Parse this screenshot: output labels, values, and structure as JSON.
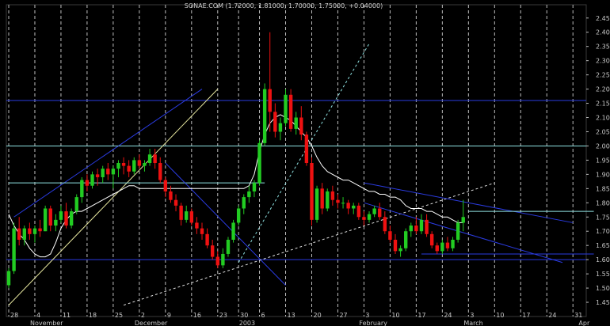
{
  "chart_data": {
    "type": "candlestick",
    "title": "SONAE.COM (1.72000, 1.81000, 1.70000, 1.75000, +0.04000)",
    "xlabel": "",
    "ylabel": "",
    "ylim": [
      1.4,
      2.48
    ],
    "y_ticks": [
      "2.45",
      "2.40",
      "2.35",
      "2.30",
      "2.25",
      "2.20",
      "2.15",
      "2.10",
      "2.05",
      "2.00",
      "1.95",
      "1.90",
      "1.85",
      "1.80",
      "1.75",
      "1.70",
      "1.65",
      "1.60",
      "1.55",
      "1.50",
      "1.45"
    ],
    "x_day_ticks": [
      {
        "label": "28",
        "i": 0
      },
      {
        "label": "4",
        "i": 5
      },
      {
        "label": "11",
        "i": 10
      },
      {
        "label": "18",
        "i": 15
      },
      {
        "label": "25",
        "i": 20
      },
      {
        "label": "2",
        "i": 25
      },
      {
        "label": "9",
        "i": 30
      },
      {
        "label": "16",
        "i": 35
      },
      {
        "label": "23",
        "i": 40
      },
      {
        "label": "30",
        "i": 44
      },
      {
        "label": "6",
        "i": 48
      },
      {
        "label": "13",
        "i": 53
      },
      {
        "label": "20",
        "i": 58
      },
      {
        "label": "27",
        "i": 63
      },
      {
        "label": "3",
        "i": 68
      },
      {
        "label": "10",
        "i": 73
      },
      {
        "label": "17",
        "i": 78
      },
      {
        "label": "24",
        "i": 83
      },
      {
        "label": "3",
        "i": 88
      },
      {
        "label": "10",
        "i": 93
      },
      {
        "label": "17",
        "i": 98
      },
      {
        "label": "24",
        "i": 103
      },
      {
        "label": "31",
        "i": 108
      }
    ],
    "x_month_ticks": [
      {
        "label": "November",
        "i": 5
      },
      {
        "label": "December",
        "i": 25
      },
      {
        "label": "2003",
        "i": 45
      },
      {
        "label": "February",
        "i": 68
      },
      {
        "label": "March",
        "i": 88
      },
      {
        "label": "Apr",
        "i": 110
      }
    ],
    "horizontal_levels": [
      2.16,
      2.0,
      1.6
    ],
    "series": [
      {
        "name": "",
        "ohlc": [
          [
            1.51,
            1.57,
            1.5,
            1.56
          ],
          [
            1.56,
            1.73,
            1.55,
            1.71
          ],
          [
            1.71,
            1.75,
            1.65,
            1.67
          ],
          [
            1.67,
            1.72,
            1.65,
            1.71
          ],
          [
            1.71,
            1.73,
            1.67,
            1.69
          ],
          [
            1.69,
            1.72,
            1.66,
            1.71
          ],
          [
            1.71,
            1.74,
            1.68,
            1.7
          ],
          [
            1.7,
            1.79,
            1.7,
            1.78
          ],
          [
            1.78,
            1.79,
            1.7,
            1.72
          ],
          [
            1.72,
            1.76,
            1.7,
            1.74
          ],
          [
            1.74,
            1.79,
            1.73,
            1.77
          ],
          [
            1.77,
            1.8,
            1.71,
            1.72
          ],
          [
            1.72,
            1.78,
            1.71,
            1.77
          ],
          [
            1.77,
            1.83,
            1.76,
            1.82
          ],
          [
            1.82,
            1.89,
            1.8,
            1.88
          ],
          [
            1.88,
            1.9,
            1.84,
            1.86
          ],
          [
            1.86,
            1.91,
            1.85,
            1.9
          ],
          [
            1.9,
            1.92,
            1.86,
            1.89
          ],
          [
            1.89,
            1.93,
            1.87,
            1.92
          ],
          [
            1.92,
            1.94,
            1.88,
            1.9
          ],
          [
            1.9,
            1.93,
            1.85,
            1.92
          ],
          [
            1.92,
            1.95,
            1.89,
            1.94
          ],
          [
            1.94,
            1.96,
            1.9,
            1.93
          ],
          [
            1.93,
            1.95,
            1.89,
            1.91
          ],
          [
            1.91,
            1.96,
            1.9,
            1.95
          ],
          [
            1.95,
            1.97,
            1.92,
            1.93
          ],
          [
            1.93,
            1.95,
            1.91,
            1.94
          ],
          [
            1.94,
            1.99,
            1.93,
            1.97
          ],
          [
            1.97,
            1.99,
            1.92,
            1.94
          ],
          [
            1.94,
            1.96,
            1.87,
            1.88
          ],
          [
            1.88,
            1.89,
            1.82,
            1.84
          ],
          [
            1.84,
            1.86,
            1.8,
            1.81
          ],
          [
            1.81,
            1.83,
            1.77,
            1.79
          ],
          [
            1.79,
            1.8,
            1.72,
            1.74
          ],
          [
            1.74,
            1.79,
            1.73,
            1.77
          ],
          [
            1.77,
            1.78,
            1.72,
            1.73
          ],
          [
            1.73,
            1.75,
            1.69,
            1.71
          ],
          [
            1.71,
            1.73,
            1.67,
            1.69
          ],
          [
            1.69,
            1.71,
            1.64,
            1.65
          ],
          [
            1.65,
            1.67,
            1.6,
            1.61
          ],
          [
            1.61,
            1.63,
            1.57,
            1.58
          ],
          [
            1.58,
            1.64,
            1.57,
            1.62
          ],
          [
            1.62,
            1.68,
            1.61,
            1.67
          ],
          [
            1.67,
            1.74,
            1.66,
            1.73
          ],
          [
            1.73,
            1.79,
            1.72,
            1.78
          ],
          [
            1.78,
            1.83,
            1.76,
            1.82
          ],
          [
            1.82,
            1.86,
            1.8,
            1.84
          ],
          [
            1.84,
            1.88,
            1.82,
            1.87
          ],
          [
            1.87,
            2.02,
            1.86,
            2.01
          ],
          [
            2.01,
            2.22,
            2.0,
            2.2
          ],
          [
            2.2,
            2.4,
            2.05,
            2.12
          ],
          [
            2.12,
            2.15,
            2.03,
            2.05
          ],
          [
            2.05,
            2.1,
            2.02,
            2.08
          ],
          [
            2.08,
            2.2,
            2.07,
            2.18
          ],
          [
            2.18,
            2.2,
            2.05,
            2.06
          ],
          [
            2.06,
            2.12,
            2.04,
            2.1
          ],
          [
            2.1,
            2.14,
            2.02,
            2.04
          ],
          [
            2.04,
            2.05,
            1.93,
            1.94
          ],
          [
            1.94,
            1.96,
            1.72,
            1.74
          ],
          [
            1.74,
            1.86,
            1.73,
            1.85
          ],
          [
            1.85,
            1.87,
            1.76,
            1.78
          ],
          [
            1.78,
            1.85,
            1.77,
            1.84
          ],
          [
            1.84,
            1.86,
            1.79,
            1.81
          ],
          [
            1.81,
            1.83,
            1.78,
            1.8
          ],
          [
            1.8,
            1.82,
            1.78,
            1.8
          ],
          [
            1.8,
            1.81,
            1.76,
            1.78
          ],
          [
            1.78,
            1.8,
            1.76,
            1.79
          ],
          [
            1.79,
            1.8,
            1.74,
            1.75
          ],
          [
            1.75,
            1.77,
            1.72,
            1.74
          ],
          [
            1.74,
            1.77,
            1.73,
            1.76
          ],
          [
            1.76,
            1.79,
            1.75,
            1.78
          ],
          [
            1.78,
            1.8,
            1.74,
            1.75
          ],
          [
            1.75,
            1.77,
            1.69,
            1.7
          ],
          [
            1.7,
            1.72,
            1.66,
            1.67
          ],
          [
            1.67,
            1.69,
            1.62,
            1.63
          ],
          [
            1.63,
            1.65,
            1.61,
            1.64
          ],
          [
            1.64,
            1.71,
            1.63,
            1.7
          ],
          [
            1.7,
            1.73,
            1.68,
            1.72
          ],
          [
            1.72,
            1.75,
            1.69,
            1.7
          ],
          [
            1.7,
            1.76,
            1.69,
            1.74
          ],
          [
            1.74,
            1.76,
            1.68,
            1.69
          ],
          [
            1.69,
            1.7,
            1.64,
            1.65
          ],
          [
            1.65,
            1.66,
            1.62,
            1.63
          ],
          [
            1.63,
            1.67,
            1.62,
            1.66
          ],
          [
            1.66,
            1.68,
            1.63,
            1.64
          ],
          [
            1.64,
            1.68,
            1.63,
            1.67
          ],
          [
            1.67,
            1.74,
            1.66,
            1.73
          ],
          [
            1.73,
            1.81,
            1.7,
            1.75
          ]
        ]
      },
      {
        "name": "",
        "type": "moving_average",
        "values": [
          1.76,
          1.72,
          1.69,
          1.67,
          1.64,
          1.62,
          1.61,
          1.61,
          1.62,
          1.66,
          1.71,
          1.74,
          1.76,
          1.77,
          1.77,
          1.78,
          1.79,
          1.8,
          1.81,
          1.82,
          1.83,
          1.84,
          1.85,
          1.86,
          1.86,
          1.85,
          1.85,
          1.85,
          1.85,
          1.85,
          1.85,
          1.85,
          1.85,
          1.85,
          1.85,
          1.85,
          1.85,
          1.85,
          1.85,
          1.85,
          1.85,
          1.85,
          1.85,
          1.85,
          1.85,
          1.85,
          1.86,
          1.9,
          1.98,
          2.04,
          2.08,
          2.1,
          2.11,
          2.1,
          2.09,
          2.07,
          2.05,
          2.03,
          2.0,
          1.96,
          1.93,
          1.91,
          1.9,
          1.89,
          1.88,
          1.88,
          1.87,
          1.86,
          1.85,
          1.84,
          1.84,
          1.83,
          1.83,
          1.82,
          1.82,
          1.81,
          1.79,
          1.78,
          1.78,
          1.78,
          1.77,
          1.77,
          1.76,
          1.75,
          1.75,
          1.74,
          1.73,
          1.73
        ]
      }
    ]
  }
}
